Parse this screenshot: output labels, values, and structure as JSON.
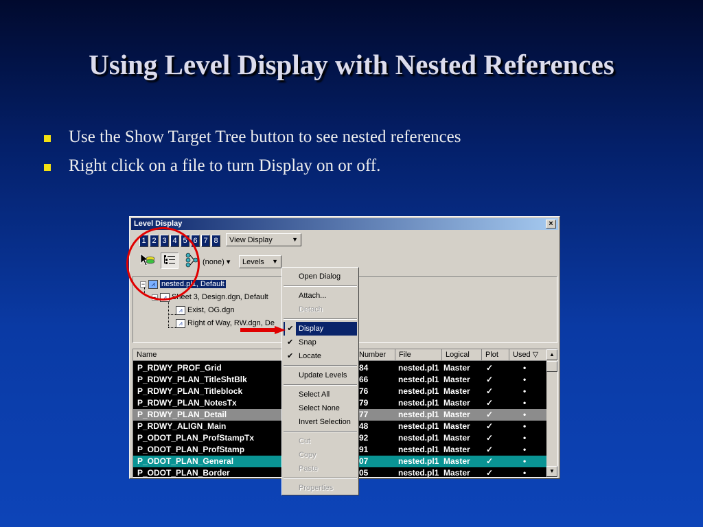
{
  "slide": {
    "title": "Using Level Display with Nested References",
    "bullets": [
      "Use the Show Target Tree button to see nested references",
      "Right click on a file to turn Display on or off."
    ]
  },
  "dialog": {
    "title": "Level Display",
    "close_glyph": "×",
    "level_buttons": [
      "1",
      "2",
      "3",
      "4",
      "5",
      "6",
      "7",
      "8"
    ],
    "view_display": "View Display",
    "filter": "(none) ▾",
    "levels_combo": "Levels",
    "tree": [
      "nested.pl1, Default",
      "Sheet 3, Design.dgn, Default",
      "Exist, OG.dgn",
      "Right of Way, RW.dgn, De"
    ],
    "columns": [
      "Name",
      "Number",
      "File",
      "Logical",
      "Plot",
      "Used ▽"
    ],
    "rows": [
      {
        "name": "P_RDWY_PROF_Grid",
        "number": "84",
        "file": "nested.pl1",
        "logical": "Master",
        "plot": "✓",
        "used": "•"
      },
      {
        "name": "P_RDWY_PLAN_TitleShtBlk",
        "number": "66",
        "file": "nested.pl1",
        "logical": "Master",
        "plot": "✓",
        "used": "•"
      },
      {
        "name": "P_RDWY_PLAN_Titleblock",
        "number": "76",
        "file": "nested.pl1",
        "logical": "Master",
        "plot": "✓",
        "used": "•"
      },
      {
        "name": "P_RDWY_PLAN_NotesTx",
        "number": "79",
        "file": "nested.pl1",
        "logical": "Master",
        "plot": "✓",
        "used": "•"
      },
      {
        "name": "P_RDWY_PLAN_Detail",
        "number": "77",
        "file": "nested.pl1",
        "logical": "Master",
        "plot": "✓",
        "used": "•"
      },
      {
        "name": "P_RDWY_ALIGN_Main",
        "number": "48",
        "file": "nested.pl1",
        "logical": "Master",
        "plot": "✓",
        "used": "•"
      },
      {
        "name": "P_ODOT_PLAN_ProfStampTx",
        "number": "92",
        "file": "nested.pl1",
        "logical": "Master",
        "plot": "✓",
        "used": "•"
      },
      {
        "name": "P_ODOT_PLAN_ProfStamp",
        "number": "91",
        "file": "nested.pl1",
        "logical": "Master",
        "plot": "✓",
        "used": "•"
      },
      {
        "name": "P_ODOT_PLAN_General",
        "number": "07",
        "file": "nested.pl1",
        "logical": "Master",
        "plot": "✓",
        "used": "•"
      },
      {
        "name": "P_ODOT_PLAN_Border",
        "number": "05",
        "file": "nested.pl1",
        "logical": "Master",
        "plot": "✓",
        "used": "•"
      }
    ],
    "scroll_up": "▲",
    "scroll_down": "▼"
  },
  "context_menu": {
    "items": [
      {
        "label": "Open Dialog",
        "state": "normal"
      },
      {
        "label": "Attach...",
        "state": "normal"
      },
      {
        "label": "Detach",
        "state": "disabled"
      },
      {
        "label": "Display",
        "state": "highlight",
        "check": "✔"
      },
      {
        "label": "Snap",
        "state": "normal",
        "check": "✔"
      },
      {
        "label": "Locate",
        "state": "normal",
        "check": "✔"
      },
      {
        "label": "Update Levels",
        "state": "normal"
      },
      {
        "label": "Select All",
        "state": "normal"
      },
      {
        "label": "Select None",
        "state": "normal"
      },
      {
        "label": "Invert Selection",
        "state": "normal"
      },
      {
        "label": "Cut",
        "state": "disabled"
      },
      {
        "label": "Copy",
        "state": "disabled"
      },
      {
        "label": "Paste",
        "state": "disabled"
      },
      {
        "label": "Properties",
        "state": "disabled"
      }
    ]
  },
  "icons": {
    "element-selection": "↖",
    "toggle-list": "☷",
    "show-target-tree": "⌥"
  },
  "colors": {
    "bullet": "#f4e011",
    "annotation": "#e00000",
    "selection": "#0a246a",
    "row_teal": "#0a9494",
    "row_gray": "#8c8c8c"
  }
}
